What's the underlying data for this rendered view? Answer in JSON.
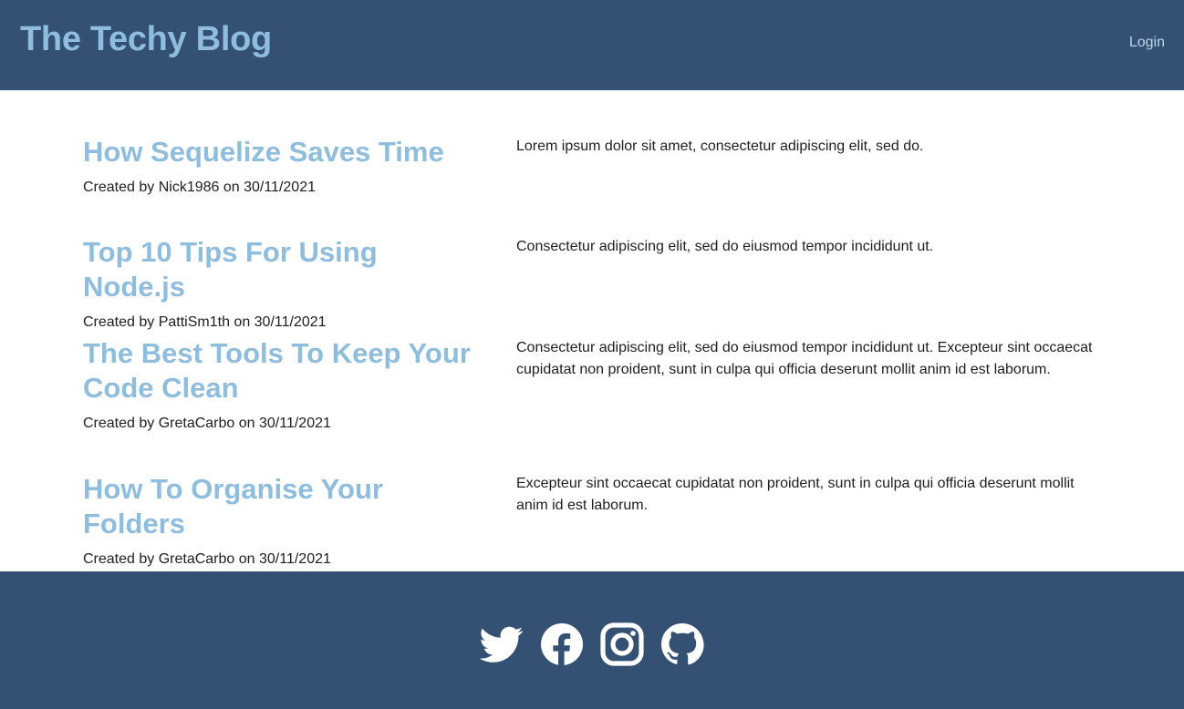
{
  "header": {
    "title": "The Techy Blog",
    "login_label": "Login"
  },
  "posts": [
    {
      "title": "How Sequelize Saves Time",
      "meta": "Created by Nick1986 on 30/11/2021",
      "excerpt": "Lorem ipsum dolor sit amet, consectetur adipiscing elit, sed do."
    },
    {
      "title": "Top 10 Tips For Using Node.js",
      "meta": "Created by PattiSm1th on 30/11/2021",
      "excerpt": "Consectetur adipiscing elit, sed do eiusmod tempor incididunt ut."
    },
    {
      "title": "The Best Tools To Keep Your Code Clean",
      "meta": "Created by GretaCarbo on 30/11/2021",
      "excerpt": "Consectetur adipiscing elit, sed do eiusmod tempor incididunt ut. Excepteur sint occaecat cupidatat non proident, sunt in culpa qui officia deserunt mollit anim id est laborum."
    },
    {
      "title": "How To Organise Your Folders",
      "meta": "Created by GretaCarbo on 30/11/2021",
      "excerpt": "Excepteur sint occaecat cupidatat non proident, sunt in culpa qui officia deserunt mollit anim id est laborum."
    }
  ],
  "footer": {
    "social_icons": [
      "twitter-icon",
      "facebook-icon",
      "instagram-icon",
      "github-icon"
    ]
  },
  "colors": {
    "header_bg": "#345173",
    "accent": "#8ebddd",
    "text": "#1e1e1e",
    "icon": "#ffffff"
  }
}
